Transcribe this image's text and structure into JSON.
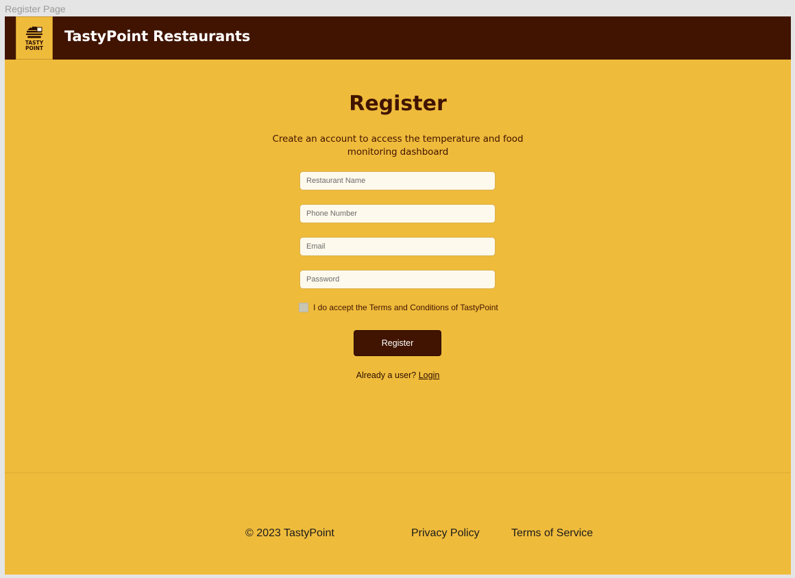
{
  "frame_label": "Register Page",
  "header": {
    "logo": {
      "line1": "TASTY",
      "line2": "POINT"
    },
    "brand": "TastyPoint Restaurants"
  },
  "form": {
    "title": "Register",
    "subtitle": "Create an account to access the temperature and food monitoring dashboard",
    "fields": {
      "restaurant_name": {
        "placeholder": "Restaurant Name",
        "value": ""
      },
      "phone_number": {
        "placeholder": "Phone Number",
        "value": ""
      },
      "email": {
        "placeholder": "Email",
        "value": ""
      },
      "password": {
        "placeholder": "Password",
        "value": ""
      }
    },
    "terms_label": "I do accept the Terms and Conditions of TastyPoint",
    "terms_checked": false,
    "submit_label": "Register",
    "already_text": "Already a user?",
    "login_link": "Login"
  },
  "footer": {
    "copyright": "© 2023 TastyPoint",
    "privacy": "Privacy Policy",
    "terms": "Terms of Service"
  },
  "colors": {
    "background": "#efbb3b",
    "header": "#411401",
    "accent": "#411401",
    "input_bg": "#fdf9ec"
  }
}
